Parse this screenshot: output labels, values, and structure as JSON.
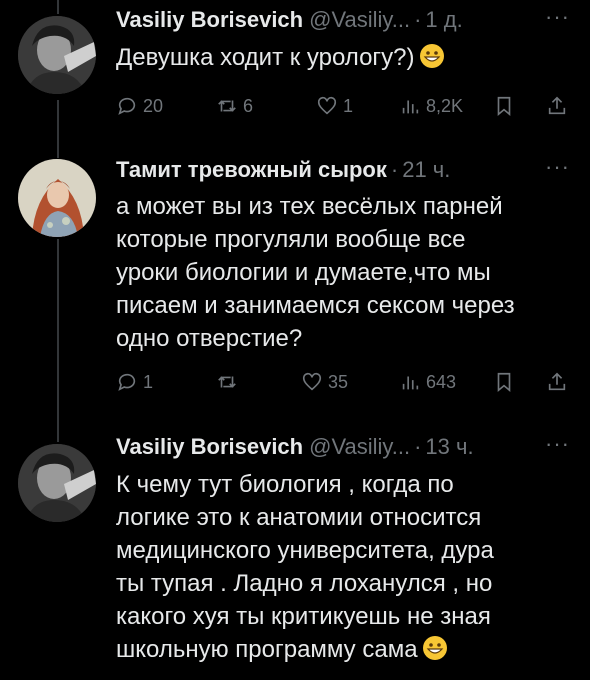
{
  "tweets": [
    {
      "author_name": "Vasiliy Borisevich",
      "handle": "@Vasiliy...",
      "time": "1 д.",
      "text": "Девушка ходит к урологу?)",
      "emoji": "grinning-face",
      "actions": {
        "replies": "20",
        "retweets": "6",
        "likes": "1",
        "views": "8,2K"
      }
    },
    {
      "author_name": "Тамит тревожный сырок",
      "handle": "",
      "time": "21 ч.",
      "text": "а может вы из тех весёлых парней\nкоторые прогуляли вообще все\nуроки биологии и думаете,что мы\nписаем и занимаемся сексом через\nодно отверстие?",
      "actions": {
        "replies": "1",
        "retweets": "",
        "likes": "35",
        "views": "643"
      }
    },
    {
      "author_name": "Vasiliy Borisevich",
      "handle": "@Vasiliy...",
      "time": "13 ч.",
      "text": "К чему тут биология , когда по\nлогике это к анатомии относится\nмедицинского университета, дура\nты тупая . Ладно я лоханулся , но\nкакого хуя ты критикуешь не зная\nшкольную программу сама",
      "emoji": "grinning-face"
    }
  ],
  "ui": {
    "separator_dot": "·",
    "more_glyph": "···"
  },
  "colors": {
    "background": "#000000",
    "text": "#e7e9ea",
    "muted": "#71767b",
    "emoji": "#f7c634"
  }
}
